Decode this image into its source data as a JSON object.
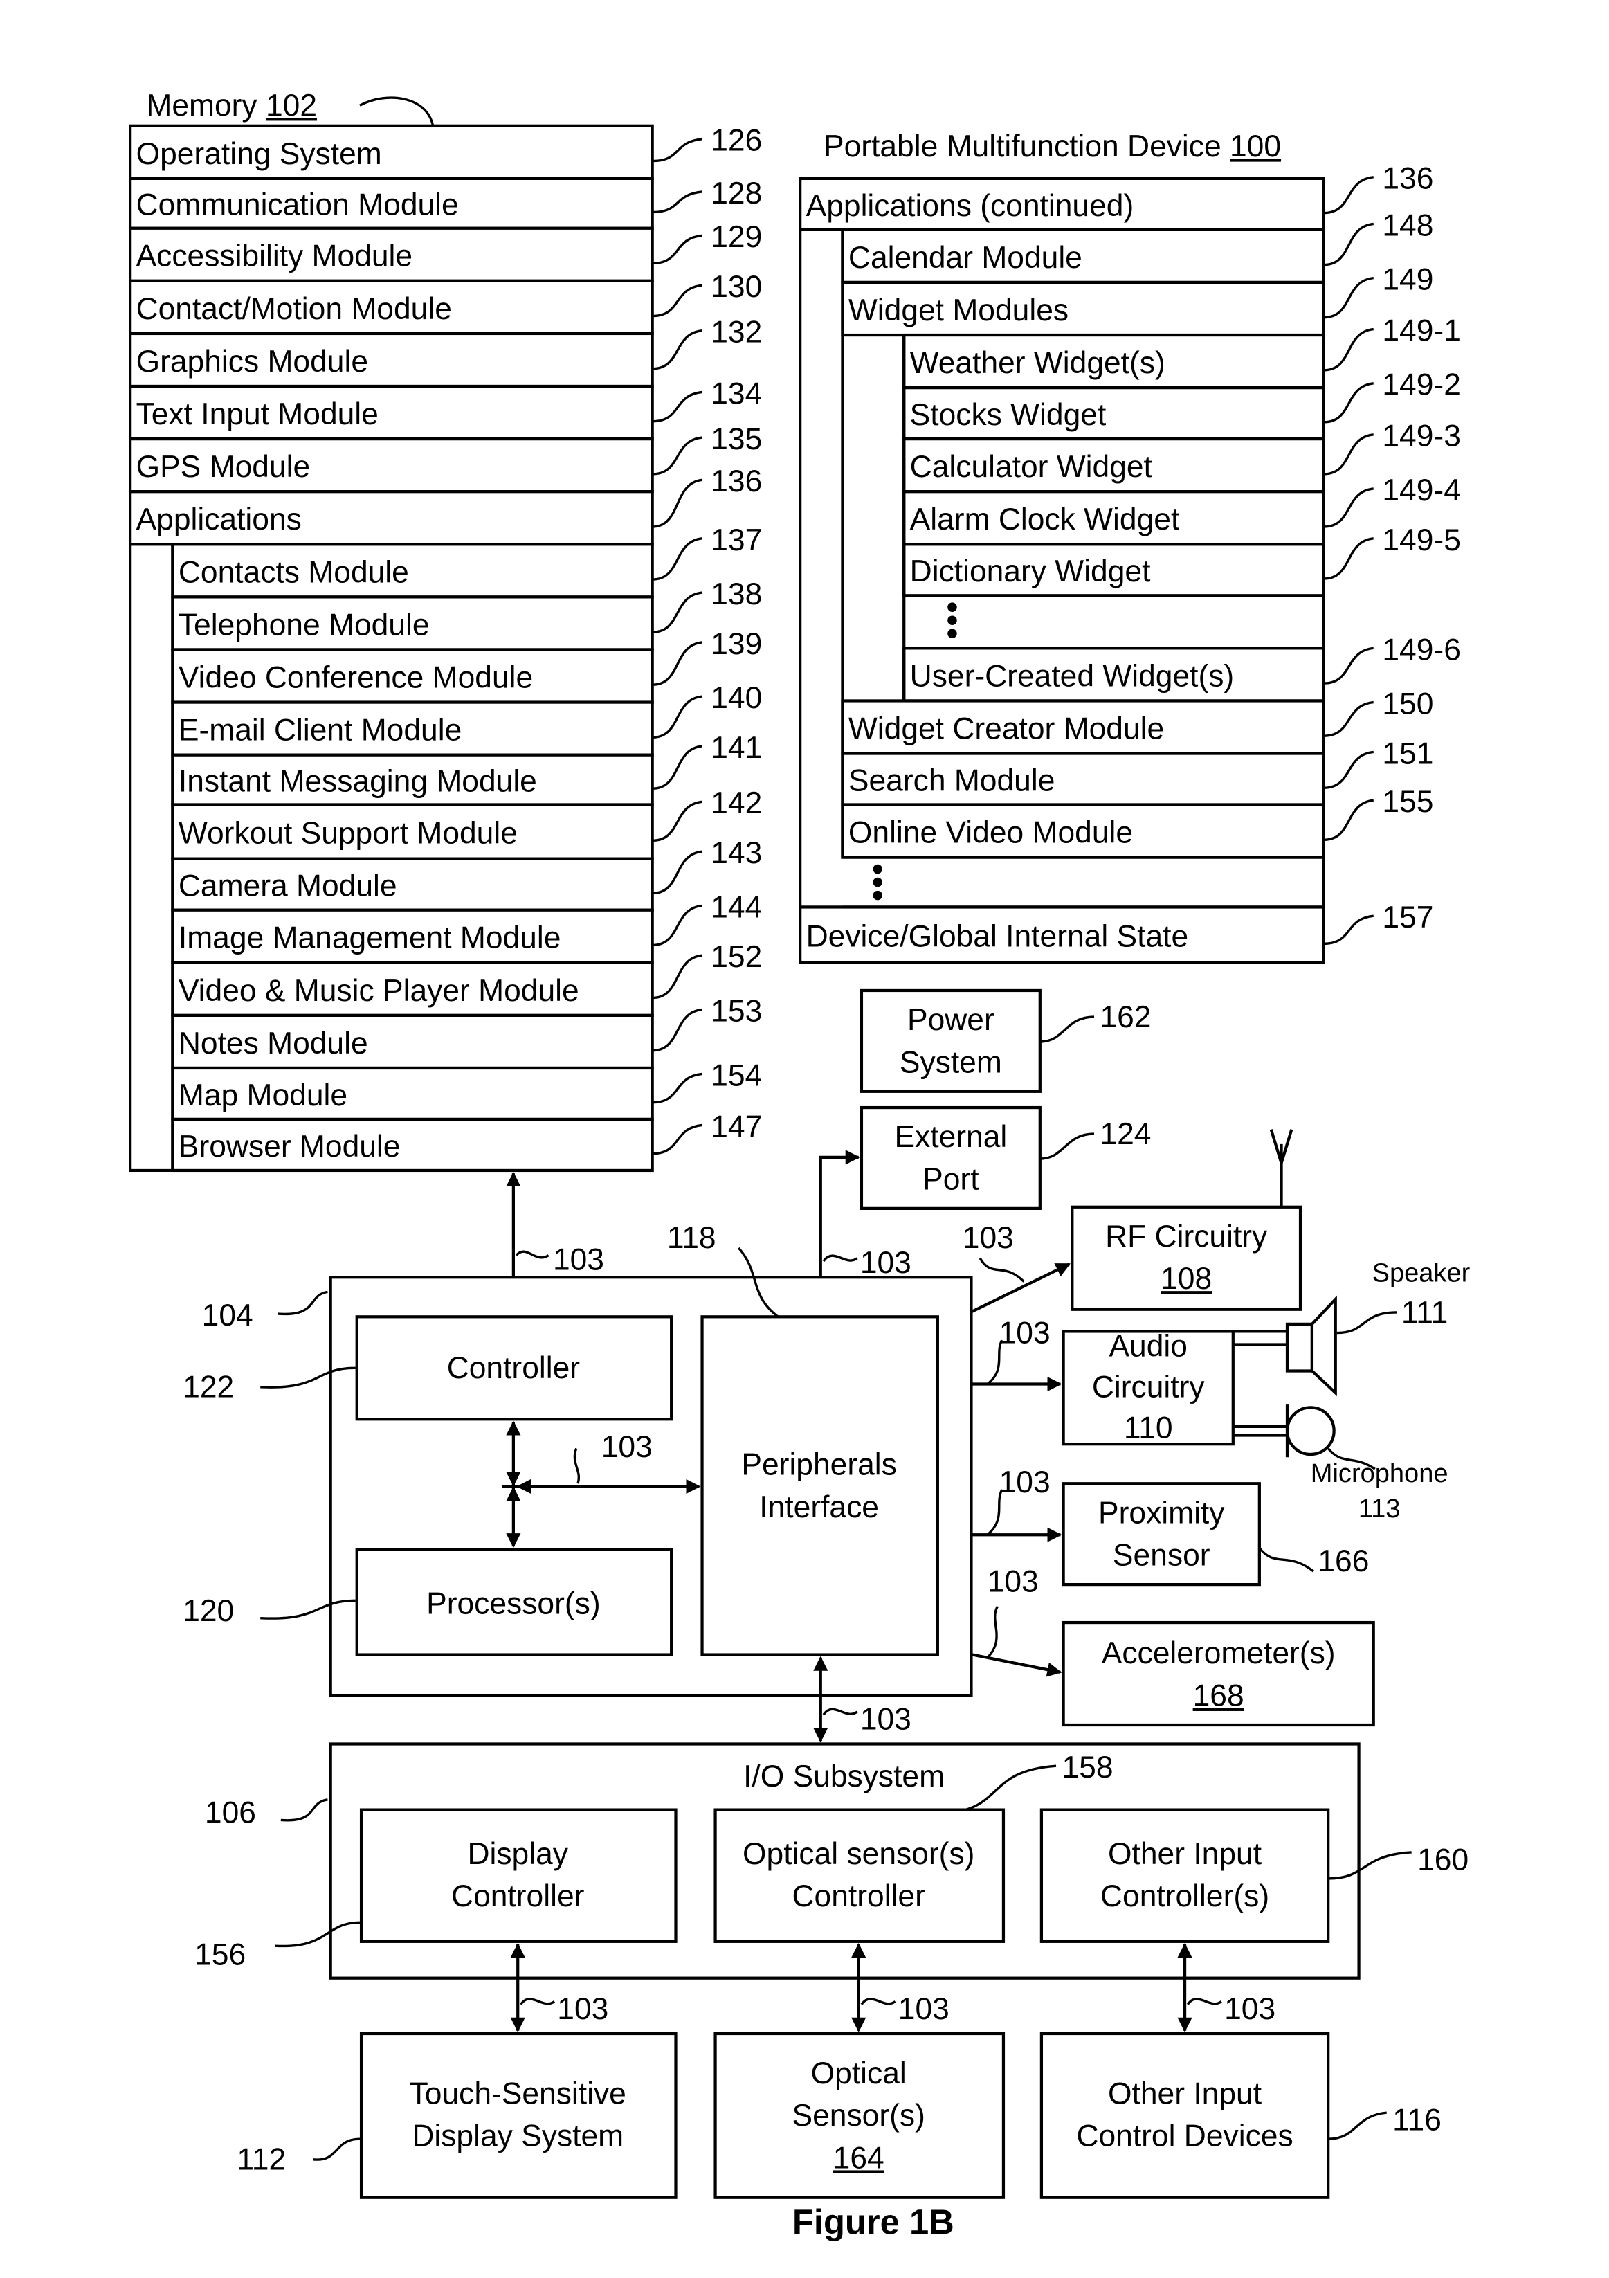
{
  "figure": {
    "caption": "Figure 1B",
    "colors": {
      "ink": "#000000",
      "paper": "#ffffff"
    }
  },
  "memory": {
    "title": "Memory",
    "title_ref": "102",
    "items": [
      {
        "label": "Operating System",
        "ref": "126",
        "level": 0
      },
      {
        "label": "Communication Module",
        "ref": "128",
        "level": 0
      },
      {
        "label": "Accessibility Module",
        "ref": "129",
        "level": 0
      },
      {
        "label": "Contact/Motion Module",
        "ref": "130",
        "level": 0
      },
      {
        "label": "Graphics Module",
        "ref": "132",
        "level": 0
      },
      {
        "label": "Text Input Module",
        "ref": "134",
        "level": 0
      },
      {
        "label": "GPS Module",
        "ref": "135",
        "level": 0
      },
      {
        "label": "Applications",
        "ref": "136",
        "level": 0
      },
      {
        "label": "Contacts Module",
        "ref": "137",
        "level": 1
      },
      {
        "label": "Telephone Module",
        "ref": "138",
        "level": 1
      },
      {
        "label": "Video Conference Module",
        "ref": "139",
        "level": 1
      },
      {
        "label": "E-mail Client Module",
        "ref": "140",
        "level": 1
      },
      {
        "label": "Instant Messaging Module",
        "ref": "141",
        "level": 1
      },
      {
        "label": "Workout Support Module",
        "ref": "142",
        "level": 1
      },
      {
        "label": "Camera Module",
        "ref": "143",
        "level": 1
      },
      {
        "label": "Image Management Module",
        "ref": "144",
        "level": 1
      },
      {
        "label": "Video & Music Player Module",
        "ref": "152",
        "level": 1
      },
      {
        "label": "Notes Module",
        "ref": "153",
        "level": 1
      },
      {
        "label": "Map Module",
        "ref": "154",
        "level": 1
      },
      {
        "label": "Browser Module",
        "ref": "147",
        "level": 1
      }
    ]
  },
  "device": {
    "title": "Portable Multifunction Device",
    "title_ref": "100",
    "items": [
      {
        "label": "Applications (continued)",
        "ref": "136",
        "level": 0
      },
      {
        "label": "Calendar Module",
        "ref": "148",
        "level": 1
      },
      {
        "label": "Widget Modules",
        "ref": "149",
        "level": 1
      },
      {
        "label": "Weather Widget(s)",
        "ref": "149-1",
        "level": 2
      },
      {
        "label": "Stocks Widget",
        "ref": "149-2",
        "level": 2
      },
      {
        "label": "Calculator Widget",
        "ref": "149-3",
        "level": 2
      },
      {
        "label": "Alarm Clock Widget",
        "ref": "149-4",
        "level": 2
      },
      {
        "label": "Dictionary Widget",
        "ref": "149-5",
        "level": 2
      },
      {
        "label": "",
        "ref": "",
        "level": 2,
        "ellipsis": true
      },
      {
        "label": "User-Created Widget(s)",
        "ref": "149-6",
        "level": 2
      },
      {
        "label": "Widget Creator Module",
        "ref": "150",
        "level": 1
      },
      {
        "label": "Search Module",
        "ref": "151",
        "level": 1
      },
      {
        "label": "Online Video Module",
        "ref": "155",
        "level": 1
      },
      {
        "label": "",
        "ref": "",
        "level": 1,
        "ellipsis": true
      },
      {
        "label": "Device/Global Internal State",
        "ref": "157",
        "level": 0
      }
    ]
  },
  "blocks": {
    "power": {
      "line1": "Power",
      "line2": "System",
      "ref": "162"
    },
    "external_port": {
      "line1": "External",
      "line2": "Port",
      "ref": "124"
    },
    "rf": {
      "line1": "RF Circuitry",
      "num": "108"
    },
    "audio": {
      "line1": "Audio",
      "line2": "Circuitry",
      "num": "110"
    },
    "speaker": {
      "label": "Speaker",
      "ref": "111"
    },
    "microphone": {
      "label": "Microphone",
      "ref": "113"
    },
    "proximity": {
      "line1": "Proximity",
      "line2": "Sensor",
      "ref": "166"
    },
    "accelerometer": {
      "line1": "Accelerometer(s)",
      "num": "168"
    },
    "chip": {
      "ref": "104"
    },
    "controller": {
      "label": "Controller",
      "ref": "122"
    },
    "processor": {
      "label": "Processor(s)",
      "ref": "120"
    },
    "peripherals": {
      "line1": "Peripherals",
      "line2": "Interface",
      "ref": "118"
    },
    "io": {
      "title": "I/O Subsystem",
      "ref": "106",
      "optical_ref": "158"
    },
    "display_controller": {
      "line1": "Display",
      "line2": "Controller",
      "ref": "156"
    },
    "optical_controller": {
      "line1": "Optical sensor(s)",
      "line2": "Controller"
    },
    "other_input_controller": {
      "line1": "Other Input",
      "line2": "Controller(s)",
      "ref": "160"
    },
    "touch_display": {
      "line1": "Touch-Sensitive",
      "line2": "Display System",
      "ref": "112"
    },
    "optical_sensor": {
      "line1": "Optical",
      "line2": "Sensor(s)",
      "num": "164"
    },
    "other_input_devices": {
      "line1": "Other Input",
      "line2": "Control Devices",
      "ref": "116"
    }
  },
  "bus_ref": "103"
}
